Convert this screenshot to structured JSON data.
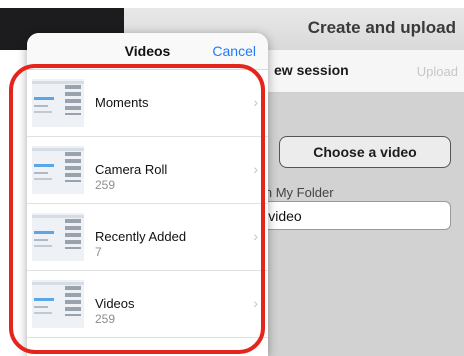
{
  "app": {
    "title": "Create and upload",
    "toolbar_title": "ew session",
    "upload_label": "Upload",
    "choose_video_label": "Choose a video",
    "folder_label": "in My Folder",
    "path_value": "e to video"
  },
  "popover": {
    "title": "Videos",
    "cancel_label": "Cancel",
    "albums": [
      {
        "name": "Moments",
        "count": ""
      },
      {
        "name": "Camera Roll",
        "count": "259"
      },
      {
        "name": "Recently Added",
        "count": "7"
      },
      {
        "name": "Videos",
        "count": "259"
      }
    ]
  },
  "colors": {
    "accent": "#1e7cf6",
    "highlight_ring": "#e4251b"
  }
}
